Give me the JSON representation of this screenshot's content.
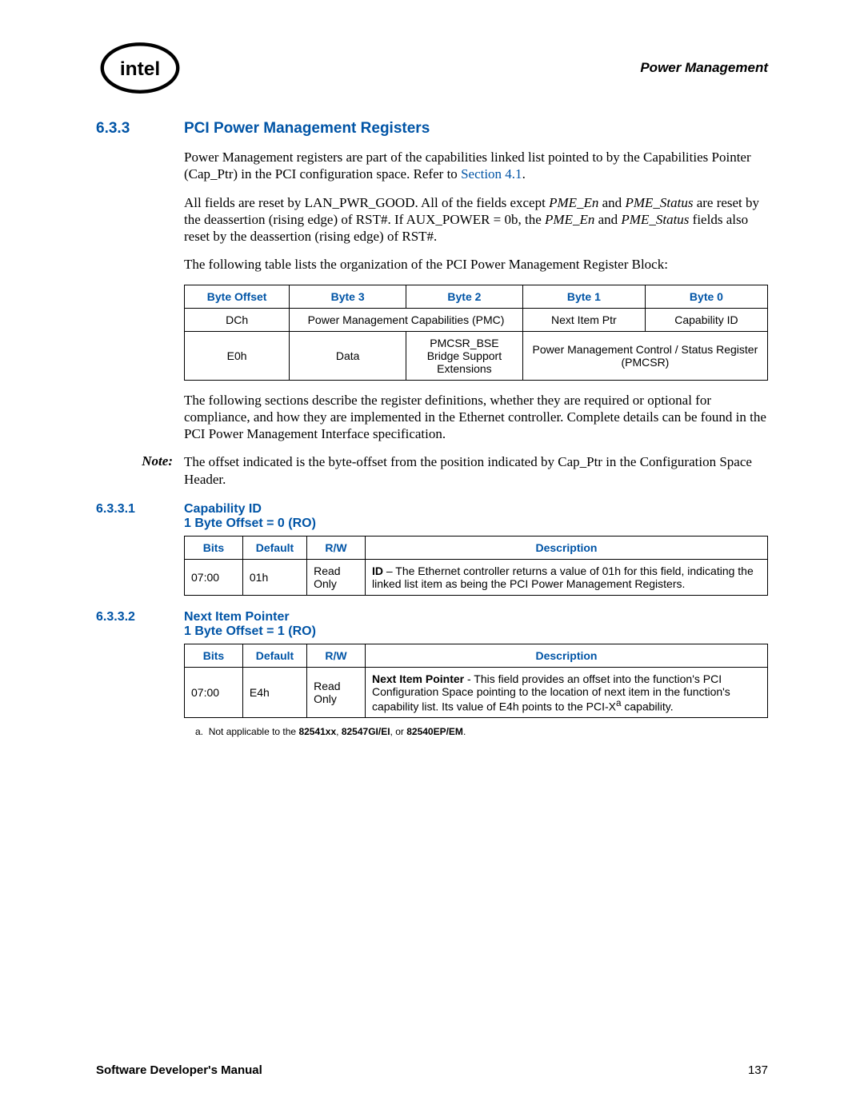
{
  "header": {
    "right": "Power Management"
  },
  "section": {
    "num": "6.3.3",
    "title": "PCI Power Management Registers",
    "para1a": "Power Management registers are part of the capabilities linked list pointed to by the Capabilities Pointer (Cap_Ptr) in the PCI configuration space. Refer to ",
    "para1link": "Section 4.1",
    "para1b": ".",
    "para2_pre": "All fields are reset by LAN_PWR_GOOD. All of the fields except ",
    "para2_i1": "PME_En",
    "para2_mid1": " and ",
    "para2_i2": "PME_Status",
    "para2_mid2": " are reset by the deassertion (rising edge) of RST#. If AUX_POWER = 0b, the ",
    "para2_i3": "PME_En",
    "para2_mid3": " and ",
    "para2_i4": "PME_Status",
    "para2_end": " fields also reset by the deassertion (rising edge) of RST#.",
    "para3": "The following table lists the organization of the PCI Power Management Register Block:",
    "para4": "The following sections describe the register definitions, whether they are required or optional for compliance, and how they are implemented in the Ethernet controller. Complete details can be found in the PCI Power Management Interface specification.",
    "note_label": "Note:",
    "note_text": "The offset indicated is the byte-offset from the position indicated by Cap_Ptr in the Configuration Space Header."
  },
  "layout_table": {
    "headers": [
      "Byte Offset",
      "Byte 3",
      "Byte 2",
      "Byte 1",
      "Byte 0"
    ],
    "rows": [
      {
        "offset": "DCh",
        "b32": "Power Management Capabilities (PMC)",
        "b1": "Next Item Ptr",
        "b0": "Capability ID"
      },
      {
        "offset": "E0h",
        "b3": "Data",
        "b2": "PMCSR_BSE Bridge Support Extensions",
        "b10": "Power Management Control / Status Register (PMCSR)"
      }
    ]
  },
  "sub1": {
    "num": "6.3.3.1",
    "title_l1": "Capability ID",
    "title_l2": "1 Byte Offset = 0 (RO)",
    "headers": [
      "Bits",
      "Default",
      "R/W",
      "Description"
    ],
    "row": {
      "bits": "07:00",
      "def": "01h",
      "rw": "Read Only",
      "desc_b": "ID",
      "desc": " – The Ethernet controller returns a value of 01h for this field, indicating the linked list item as being the PCI Power Management Registers."
    }
  },
  "sub2": {
    "num": "6.3.3.2",
    "title_l1": "Next Item Pointer",
    "title_l2": "1 Byte Offset = 1 (RO)",
    "headers": [
      "Bits",
      "Default",
      "R/W",
      "Description"
    ],
    "row": {
      "bits": "07:00",
      "def": "E4h",
      "rw": "Read Only",
      "desc_b": "Next Item Pointer",
      "desc1": " - This field provides an offset into the function's PCI Configuration Space pointing to the location of next item in the function's capability list. Its value of E4h points to the PCI-X",
      "desc_sup": "a",
      "desc2": " capability."
    },
    "footnote_label": "a.",
    "footnote_pre": "Not applicable to the ",
    "footnote_b": "82541xx",
    "footnote_mid1": ", ",
    "footnote_b2": "82547GI/EI",
    "footnote_mid2": ", or ",
    "footnote_b3": "82540EP/EM",
    "footnote_end": "."
  },
  "footer": {
    "left": "Software Developer's Manual",
    "right": "137"
  }
}
